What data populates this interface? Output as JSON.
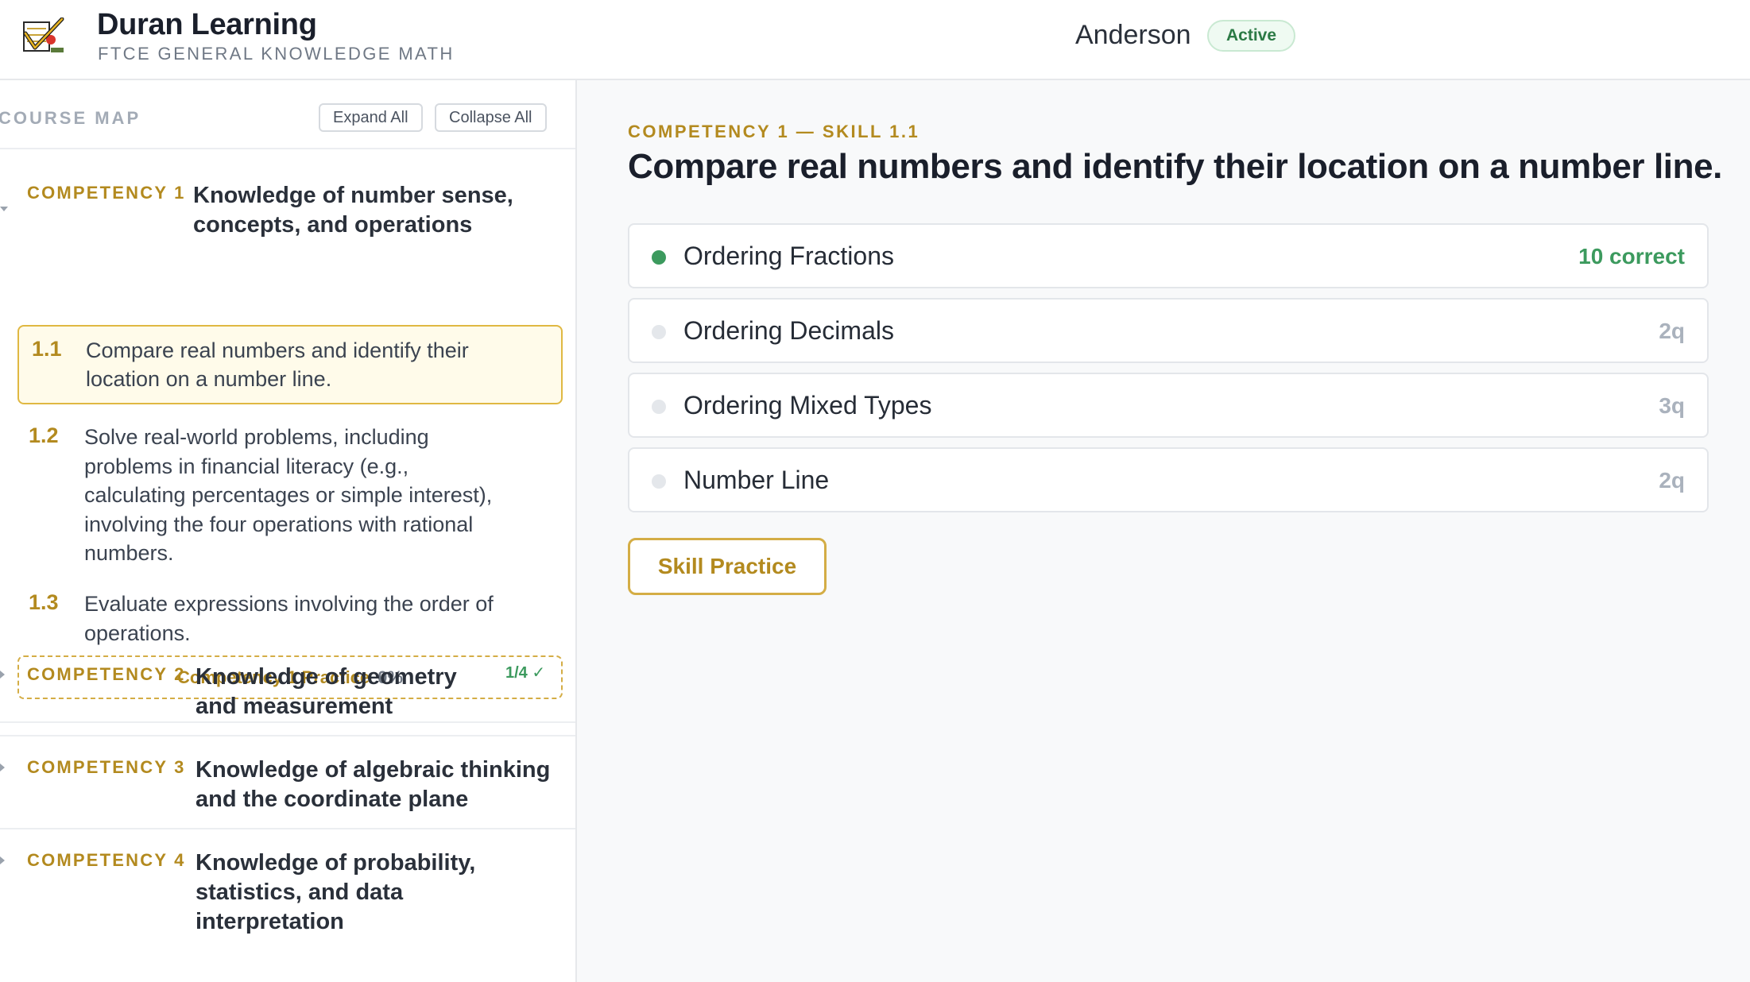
{
  "header": {
    "brand_name": "Duran Learning",
    "brand_sub": "FTCE GENERAL KNOWLEDGE MATH",
    "user_name": "Anderson",
    "status": "Active"
  },
  "sidebar": {
    "title": "COURSE MAP",
    "expand_label": "Expand All",
    "collapse_label": "Collapse All",
    "competencies": [
      {
        "label": "COMPETENCY 1",
        "title_line1": "Knowledge of number sense,",
        "title_line2": "concepts, and operations",
        "expanded": true,
        "skills": [
          {
            "num": "1.1",
            "lines": [
              "Compare real numbers and identify their",
              "location on a number line."
            ],
            "active": true
          },
          {
            "num": "1.2",
            "lines": [
              "Solve real-world problems, including",
              "problems in financial literacy (e.g.,",
              "calculating percentages or simple interest),",
              "involving the four operations with rational",
              "numbers."
            ]
          },
          {
            "num": "1.3",
            "lines": [
              "Evaluate expressions involving the order of",
              "operations."
            ]
          }
        ],
        "practice_label": "Competency 1 Practice",
        "practice_pct": "0%"
      },
      {
        "label": "COMPETENCY 2",
        "title_line1": "Knowledge of geometry",
        "title_line2": "and measurement",
        "progress": "1/4 ✓"
      },
      {
        "label": "COMPETENCY 3",
        "title_line1": "Knowledge of algebraic thinking",
        "title_line2": "and the coordinate plane"
      },
      {
        "label": "COMPETENCY 4",
        "title_line1": "Knowledge of probability,",
        "title_line2": "statistics, and data",
        "title_line3": "interpretation"
      }
    ]
  },
  "main": {
    "eyebrow": "COMPETENCY 1 — SKILL 1.1",
    "title": "Compare real numbers and identify their location on a number line.",
    "subskills": [
      {
        "name": "Ordering Fractions",
        "meta": "10 correct",
        "done": true
      },
      {
        "name": "Ordering Decimals",
        "meta": "2q",
        "done": false
      },
      {
        "name": "Ordering Mixed Types",
        "meta": "3q",
        "done": false
      },
      {
        "name": "Number Line",
        "meta": "2q",
        "done": false
      }
    ],
    "practice_button": "Skill Practice"
  },
  "colors": {
    "accent_gold": "#b38a1f",
    "success_green": "#3c9a5e",
    "active_bg": "#fffbea"
  }
}
